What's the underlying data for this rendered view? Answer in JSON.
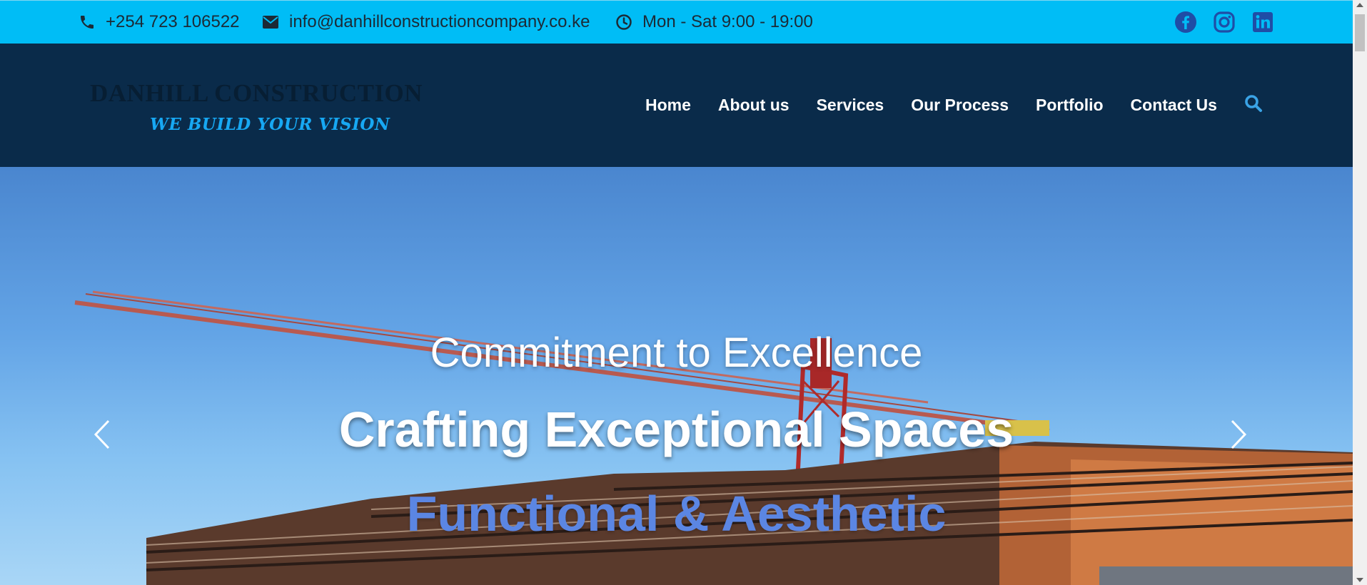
{
  "topbar": {
    "phone": {
      "icon": "phone-icon",
      "text": "+254 723 106522"
    },
    "email": {
      "icon": "envelope-icon",
      "text": "info@danhillconstructioncompany.co.ke"
    },
    "hours": {
      "icon": "clock-icon",
      "text": "Mon - Sat 9:00 - 19:00"
    },
    "socials": [
      {
        "icon": "facebook-icon"
      },
      {
        "icon": "instagram-icon"
      },
      {
        "icon": "linkedin-icon"
      }
    ],
    "colors": {
      "background": "#00bdf6",
      "icon": "#1f4da6"
    }
  },
  "header": {
    "logo_title": "DANHILL CONSTRUCTION",
    "logo_tagline": "WE BUILD YOUR VISION",
    "nav": [
      {
        "label": "Home"
      },
      {
        "label": "About us"
      },
      {
        "label": "Services"
      },
      {
        "label": "Our Process"
      },
      {
        "label": "Portfolio"
      },
      {
        "label": "Contact Us"
      }
    ],
    "search_icon": "search-icon",
    "colors": {
      "background": "#0a2b4a",
      "tagline": "#17a8f3",
      "search": "#3aa3e6"
    }
  },
  "hero": {
    "subtitle": "Commitment to Excellence",
    "title": "Crafting Exceptional Spaces",
    "accent": "Functional & Aesthetic",
    "prev_icon": "chevron-left-icon",
    "next_icon": "chevron-right-icon",
    "colors": {
      "accent": "#5b86e3"
    }
  }
}
